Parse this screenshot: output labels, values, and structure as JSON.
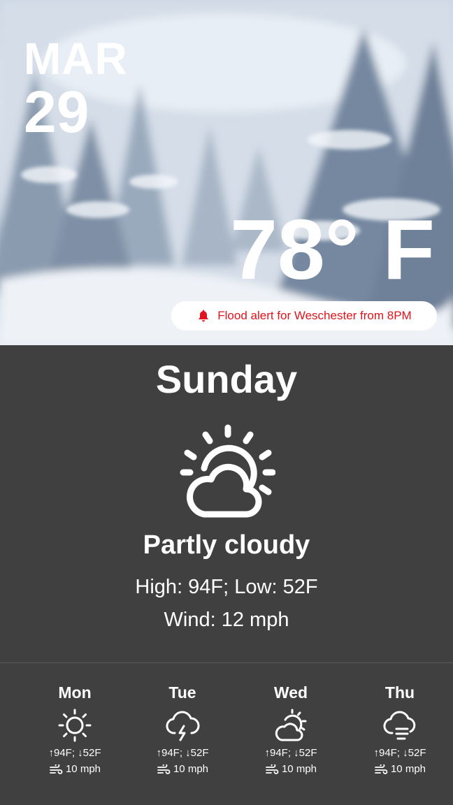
{
  "header": {
    "month": "MAR",
    "day": "29",
    "temperature": "78° F"
  },
  "alert": {
    "text": "Flood alert for Weschester from 8PM",
    "color": "#e0141c",
    "icon": "bell-icon"
  },
  "today": {
    "day_name": "Sunday",
    "icon": "partly-cloudy-icon",
    "condition": "Partly cloudy",
    "high_low": "High: 94F; Low: 52F",
    "wind": "Wind: 12 mph"
  },
  "forecast": [
    {
      "day": "Mon",
      "icon": "sun-icon",
      "high_low": "↑94F; ↓52F",
      "wind": "10 mph"
    },
    {
      "day": "Tue",
      "icon": "thunderstorm-icon",
      "high_low": "↑94F; ↓52F",
      "wind": "10 mph"
    },
    {
      "day": "Wed",
      "icon": "partly-cloudy-icon",
      "high_low": "↑94F; ↓52F",
      "wind": "10 mph"
    },
    {
      "day": "Thu",
      "icon": "fog-icon",
      "high_low": "↑94F; ↓52F",
      "wind": "10 mph"
    }
  ],
  "colors": {
    "panel_background": "#404040",
    "alert_text": "#e0141c"
  }
}
